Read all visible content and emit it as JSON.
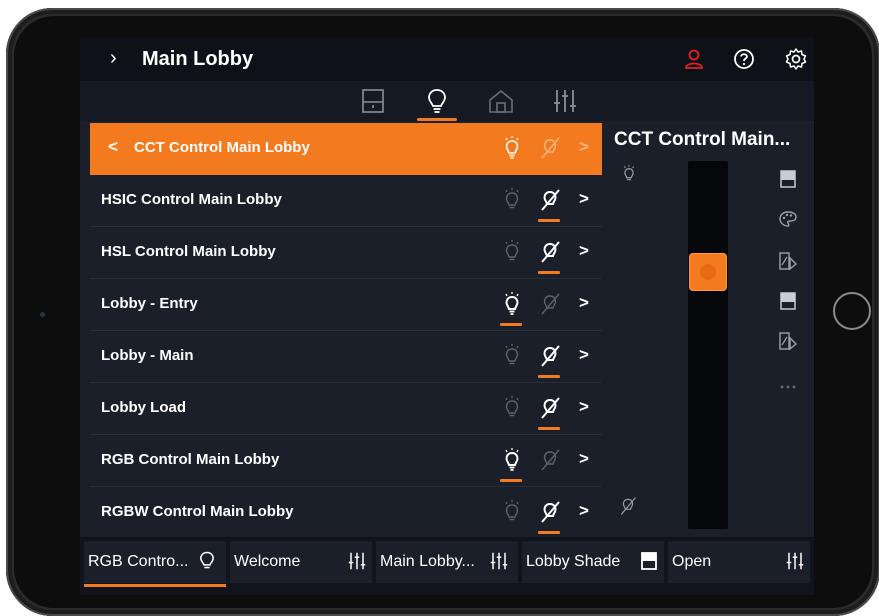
{
  "header": {
    "title": "Main Lobby",
    "expand_icon": "chevron-right-icon",
    "icons": [
      "user-icon",
      "help-icon",
      "gear-icon"
    ],
    "user_icon_color": "#e3202a"
  },
  "tabs": [
    {
      "icon": "shade-icon",
      "active": false
    },
    {
      "icon": "lightbulb-icon",
      "active": true
    },
    {
      "icon": "home-icon",
      "active": false
    },
    {
      "icon": "sliders-icon",
      "active": false
    }
  ],
  "list": {
    "header": {
      "label": "CCT Control Main Lobby",
      "back": "<",
      "arrow": ">"
    },
    "rows": [
      {
        "label": "HSIC Control Main Lobby",
        "state": "off",
        "arrow": ">"
      },
      {
        "label": "HSL Control Main Lobby",
        "state": "off",
        "arrow": ">"
      },
      {
        "label": "Lobby - Entry",
        "state": "on",
        "arrow": ">"
      },
      {
        "label": "Lobby - Main",
        "state": "off",
        "arrow": ">"
      },
      {
        "label": "Lobby Load",
        "state": "off",
        "arrow": ">"
      },
      {
        "label": "RGB Control Main Lobby",
        "state": "on",
        "arrow": ">"
      },
      {
        "label": "RGBW Control Main Lobby",
        "state": "off",
        "arrow": ">"
      }
    ]
  },
  "panel": {
    "title": "CCT Control Main...",
    "slider_level": 0.28,
    "side_icons": [
      "shade-icon",
      "palette-icon",
      "scene-icon",
      "shade-icon",
      "scene-icon",
      "more-icon"
    ]
  },
  "bottom": [
    {
      "label": "RGB Contro...",
      "icon": "lightbulb-icon",
      "active": true
    },
    {
      "label": "Welcome",
      "icon": "sliders-icon",
      "active": false
    },
    {
      "label": "Main Lobby...",
      "icon": "sliders-icon",
      "active": false
    },
    {
      "label": "Lobby Shade",
      "icon": "shade-icon",
      "active": false
    },
    {
      "label": "Open",
      "icon": "sliders-icon",
      "active": false
    }
  ],
  "colors": {
    "accent": "#f47a1f",
    "background": "#1b1f29",
    "bar": "#0f1118"
  }
}
